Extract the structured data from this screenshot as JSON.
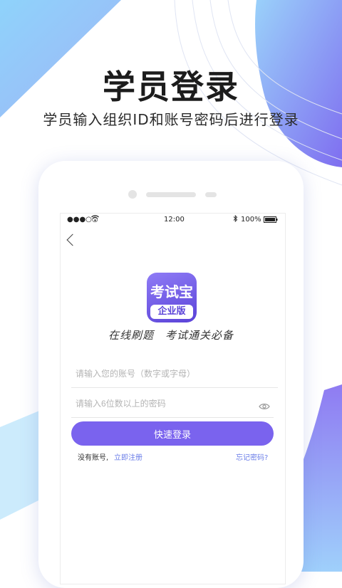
{
  "header": {
    "title": "学员登录",
    "subtitle": "学员输入组织ID和账号密码后进行登录"
  },
  "status_bar": {
    "signal": "●●●○○",
    "time": "12:00",
    "battery": "100%"
  },
  "app": {
    "logo_title": "考试宝",
    "logo_edition": "企业版",
    "slogan": "在线刷题　考试通关必备"
  },
  "form": {
    "account_placeholder": "请输入您的账号（数字或字母）",
    "account_value": "",
    "password_placeholder": "请输入6位数以上的密码",
    "password_value": "",
    "login_label": "快速登录",
    "no_account_text": "没有账号,",
    "register_link": "立即注册",
    "forgot_link": "忘记密码?"
  },
  "icons": {
    "back": "back-arrow-icon",
    "wifi": "wifi-icon",
    "bluetooth": "bluetooth-icon",
    "battery": "battery-icon",
    "eye": "eye-icon"
  },
  "colors": {
    "accent": "#7a63ee",
    "link": "#6b7ee8",
    "deco_blue": "#8fd3fb",
    "deco_purple": "#8a6cf0"
  }
}
